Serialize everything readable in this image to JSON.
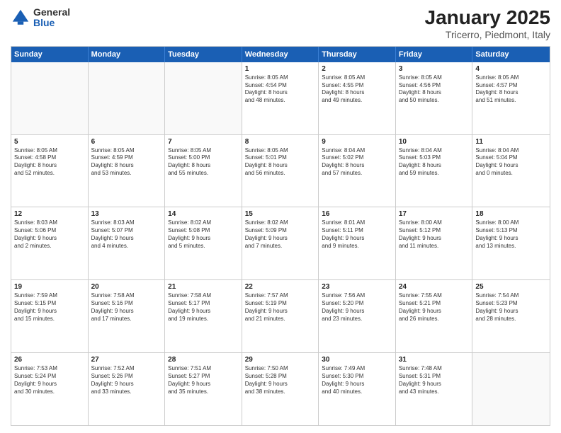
{
  "logo": {
    "general": "General",
    "blue": "Blue"
  },
  "title": "January 2025",
  "location": "Tricerro, Piedmont, Italy",
  "days": [
    "Sunday",
    "Monday",
    "Tuesday",
    "Wednesday",
    "Thursday",
    "Friday",
    "Saturday"
  ],
  "rows": [
    [
      {
        "num": "",
        "text": "",
        "empty": true
      },
      {
        "num": "",
        "text": "",
        "empty": true
      },
      {
        "num": "",
        "text": "",
        "empty": true
      },
      {
        "num": "1",
        "text": "Sunrise: 8:05 AM\nSunset: 4:54 PM\nDaylight: 8 hours\nand 48 minutes."
      },
      {
        "num": "2",
        "text": "Sunrise: 8:05 AM\nSunset: 4:55 PM\nDaylight: 8 hours\nand 49 minutes."
      },
      {
        "num": "3",
        "text": "Sunrise: 8:05 AM\nSunset: 4:56 PM\nDaylight: 8 hours\nand 50 minutes."
      },
      {
        "num": "4",
        "text": "Sunrise: 8:05 AM\nSunset: 4:57 PM\nDaylight: 8 hours\nand 51 minutes."
      }
    ],
    [
      {
        "num": "5",
        "text": "Sunrise: 8:05 AM\nSunset: 4:58 PM\nDaylight: 8 hours\nand 52 minutes."
      },
      {
        "num": "6",
        "text": "Sunrise: 8:05 AM\nSunset: 4:59 PM\nDaylight: 8 hours\nand 53 minutes."
      },
      {
        "num": "7",
        "text": "Sunrise: 8:05 AM\nSunset: 5:00 PM\nDaylight: 8 hours\nand 55 minutes."
      },
      {
        "num": "8",
        "text": "Sunrise: 8:05 AM\nSunset: 5:01 PM\nDaylight: 8 hours\nand 56 minutes."
      },
      {
        "num": "9",
        "text": "Sunrise: 8:04 AM\nSunset: 5:02 PM\nDaylight: 8 hours\nand 57 minutes."
      },
      {
        "num": "10",
        "text": "Sunrise: 8:04 AM\nSunset: 5:03 PM\nDaylight: 8 hours\nand 59 minutes."
      },
      {
        "num": "11",
        "text": "Sunrise: 8:04 AM\nSunset: 5:04 PM\nDaylight: 9 hours\nand 0 minutes."
      }
    ],
    [
      {
        "num": "12",
        "text": "Sunrise: 8:03 AM\nSunset: 5:06 PM\nDaylight: 9 hours\nand 2 minutes."
      },
      {
        "num": "13",
        "text": "Sunrise: 8:03 AM\nSunset: 5:07 PM\nDaylight: 9 hours\nand 4 minutes."
      },
      {
        "num": "14",
        "text": "Sunrise: 8:02 AM\nSunset: 5:08 PM\nDaylight: 9 hours\nand 5 minutes."
      },
      {
        "num": "15",
        "text": "Sunrise: 8:02 AM\nSunset: 5:09 PM\nDaylight: 9 hours\nand 7 minutes."
      },
      {
        "num": "16",
        "text": "Sunrise: 8:01 AM\nSunset: 5:11 PM\nDaylight: 9 hours\nand 9 minutes."
      },
      {
        "num": "17",
        "text": "Sunrise: 8:00 AM\nSunset: 5:12 PM\nDaylight: 9 hours\nand 11 minutes."
      },
      {
        "num": "18",
        "text": "Sunrise: 8:00 AM\nSunset: 5:13 PM\nDaylight: 9 hours\nand 13 minutes."
      }
    ],
    [
      {
        "num": "19",
        "text": "Sunrise: 7:59 AM\nSunset: 5:15 PM\nDaylight: 9 hours\nand 15 minutes."
      },
      {
        "num": "20",
        "text": "Sunrise: 7:58 AM\nSunset: 5:16 PM\nDaylight: 9 hours\nand 17 minutes."
      },
      {
        "num": "21",
        "text": "Sunrise: 7:58 AM\nSunset: 5:17 PM\nDaylight: 9 hours\nand 19 minutes."
      },
      {
        "num": "22",
        "text": "Sunrise: 7:57 AM\nSunset: 5:19 PM\nDaylight: 9 hours\nand 21 minutes."
      },
      {
        "num": "23",
        "text": "Sunrise: 7:56 AM\nSunset: 5:20 PM\nDaylight: 9 hours\nand 23 minutes."
      },
      {
        "num": "24",
        "text": "Sunrise: 7:55 AM\nSunset: 5:21 PM\nDaylight: 9 hours\nand 26 minutes."
      },
      {
        "num": "25",
        "text": "Sunrise: 7:54 AM\nSunset: 5:23 PM\nDaylight: 9 hours\nand 28 minutes."
      }
    ],
    [
      {
        "num": "26",
        "text": "Sunrise: 7:53 AM\nSunset: 5:24 PM\nDaylight: 9 hours\nand 30 minutes."
      },
      {
        "num": "27",
        "text": "Sunrise: 7:52 AM\nSunset: 5:26 PM\nDaylight: 9 hours\nand 33 minutes."
      },
      {
        "num": "28",
        "text": "Sunrise: 7:51 AM\nSunset: 5:27 PM\nDaylight: 9 hours\nand 35 minutes."
      },
      {
        "num": "29",
        "text": "Sunrise: 7:50 AM\nSunset: 5:28 PM\nDaylight: 9 hours\nand 38 minutes."
      },
      {
        "num": "30",
        "text": "Sunrise: 7:49 AM\nSunset: 5:30 PM\nDaylight: 9 hours\nand 40 minutes."
      },
      {
        "num": "31",
        "text": "Sunrise: 7:48 AM\nSunset: 5:31 PM\nDaylight: 9 hours\nand 43 minutes."
      },
      {
        "num": "",
        "text": "",
        "empty": true
      }
    ]
  ]
}
